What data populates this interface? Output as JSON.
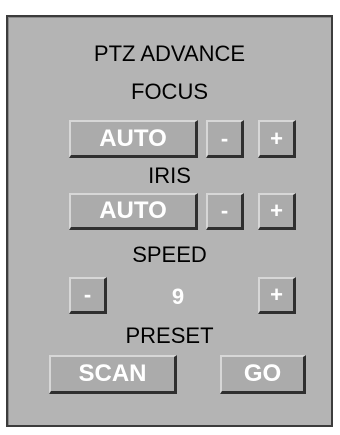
{
  "panel": {
    "title": "PTZ ADVANCE",
    "focus": {
      "label": "FOCUS",
      "mode": "AUTO",
      "minus": "-",
      "plus": "+"
    },
    "iris": {
      "label": "IRIS",
      "mode": "AUTO",
      "minus": "-",
      "plus": "+"
    },
    "speed": {
      "label": "SPEED",
      "minus": "-",
      "value": "9",
      "plus": "+"
    },
    "preset": {
      "label": "PRESET",
      "scan": "SCAN",
      "go": "GO"
    }
  },
  "colors": {
    "panel_bg": "#b4b4b4",
    "button_bg": "#ababab",
    "button_text": "#ffffff",
    "heading_text": "#000000",
    "border": "#3c3c3c"
  }
}
